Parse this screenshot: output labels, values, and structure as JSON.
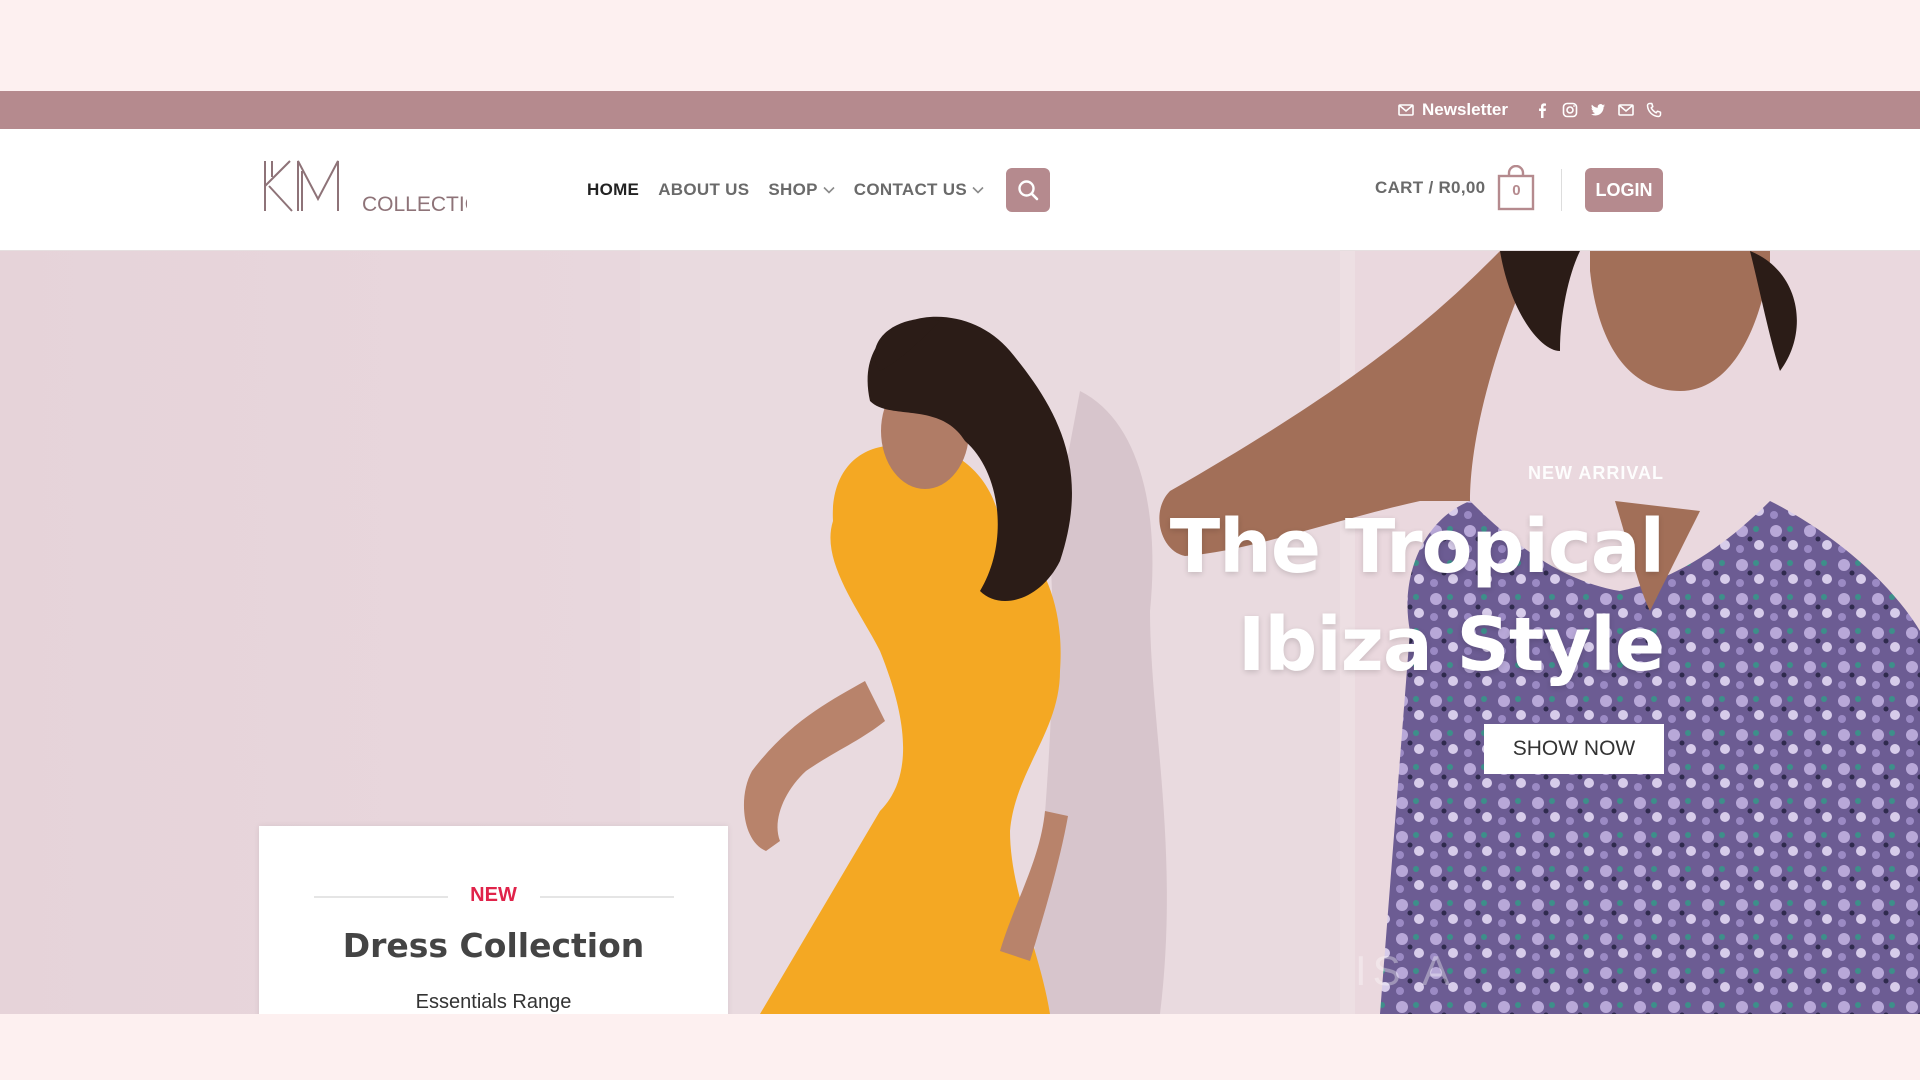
{
  "topbar": {
    "newsletter_label": "Newsletter",
    "icons": [
      "mail-icon",
      "facebook-icon",
      "instagram-icon",
      "twitter-icon",
      "email-icon",
      "phone-icon"
    ]
  },
  "header": {
    "logo_text": "KM",
    "logo_sub": "COLLECTION",
    "nav": {
      "home": "HOME",
      "about": "ABOUT US",
      "shop": "SHOP",
      "contact": "CONTACT US"
    },
    "cart_label": "CART / R0,00",
    "cart_count": "0",
    "login_label": "LOGIN"
  },
  "hero": {
    "eyebrow": "NEW ARRIVAL",
    "title_line1": "The Tropical",
    "title_line2": "Ibiza Style",
    "cta_label": "SHOW NOW",
    "ghost_text": "IS A"
  },
  "promo_card": {
    "badge": "NEW",
    "heading": "Dress Collection",
    "subheading": "Essentials Range"
  },
  "colors": {
    "accent": "#b58a8e",
    "badge_red": "#e0234a",
    "page_bg": "#fdf0f0"
  }
}
